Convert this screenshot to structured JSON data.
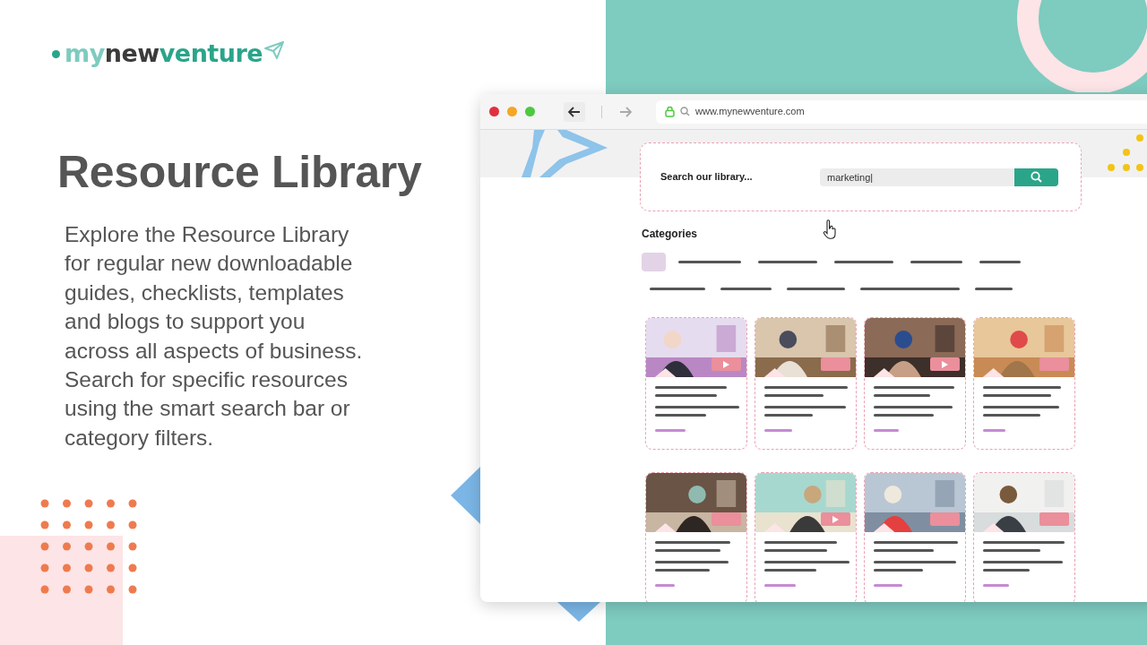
{
  "logo": {
    "parts": [
      "my",
      "new",
      "venture"
    ]
  },
  "title": "Resource Library",
  "paragraph_lines": [
    "Explore the Resource Library",
    "for regular new downloadable",
    "guides, checklists, templates",
    "and blogs to support you",
    "across all aspects of business.",
    "Search for specific resources",
    "using the smart search bar or",
    "category filters."
  ],
  "browser": {
    "url": "www.mynewventure.com"
  },
  "search": {
    "label": "Search our library...",
    "value": "marketing|"
  },
  "categories": {
    "heading": "Categories"
  },
  "cards": [
    {
      "video": true
    },
    {
      "video": false
    },
    {
      "video": true
    },
    {
      "video": false
    },
    {
      "video": false
    },
    {
      "video": true
    },
    {
      "video": false
    },
    {
      "video": false
    }
  ]
}
